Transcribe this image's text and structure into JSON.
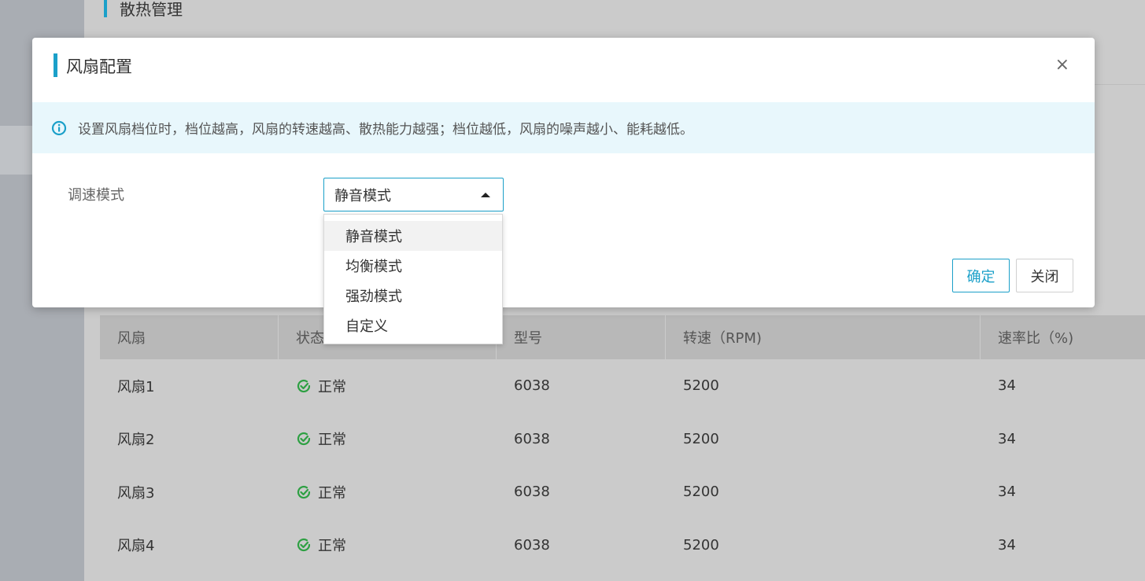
{
  "page": {
    "title": "散热管理"
  },
  "modal": {
    "title": "风扇配置",
    "close_symbol": "×",
    "notice": "设置风扇档位时，档位越高，风扇的转速越高、散热能力越强；档位越低，风扇的噪声越小、能耗越低。",
    "field_label": "调速模式",
    "select_value": "静音模式",
    "options": [
      "静音模式",
      "均衡模式",
      "强劲模式",
      "自定义"
    ],
    "confirm_label": "确定",
    "close_label": "关闭"
  },
  "table": {
    "headers": [
      "风扇",
      "状态",
      "型号",
      "转速（RPM)",
      "速率比（%)"
    ],
    "rows": [
      {
        "name": "风扇1",
        "status": "正常",
        "model": "6038",
        "rpm": "5200",
        "ratio": "34"
      },
      {
        "name": "风扇2",
        "status": "正常",
        "model": "6038",
        "rpm": "5200",
        "ratio": "34"
      },
      {
        "name": "风扇3",
        "status": "正常",
        "model": "6038",
        "rpm": "5200",
        "ratio": "34"
      },
      {
        "name": "风扇4",
        "status": "正常",
        "model": "6038",
        "rpm": "5200",
        "ratio": "34"
      }
    ]
  },
  "colors": {
    "accent": "#1ba0c9",
    "ok": "#2ea043",
    "notice_bg": "#e8f7fc"
  },
  "icons": {
    "notice": "info-circle-icon",
    "status": "check-circle-icon",
    "close": "close-icon",
    "caret": "caret-up-icon"
  }
}
